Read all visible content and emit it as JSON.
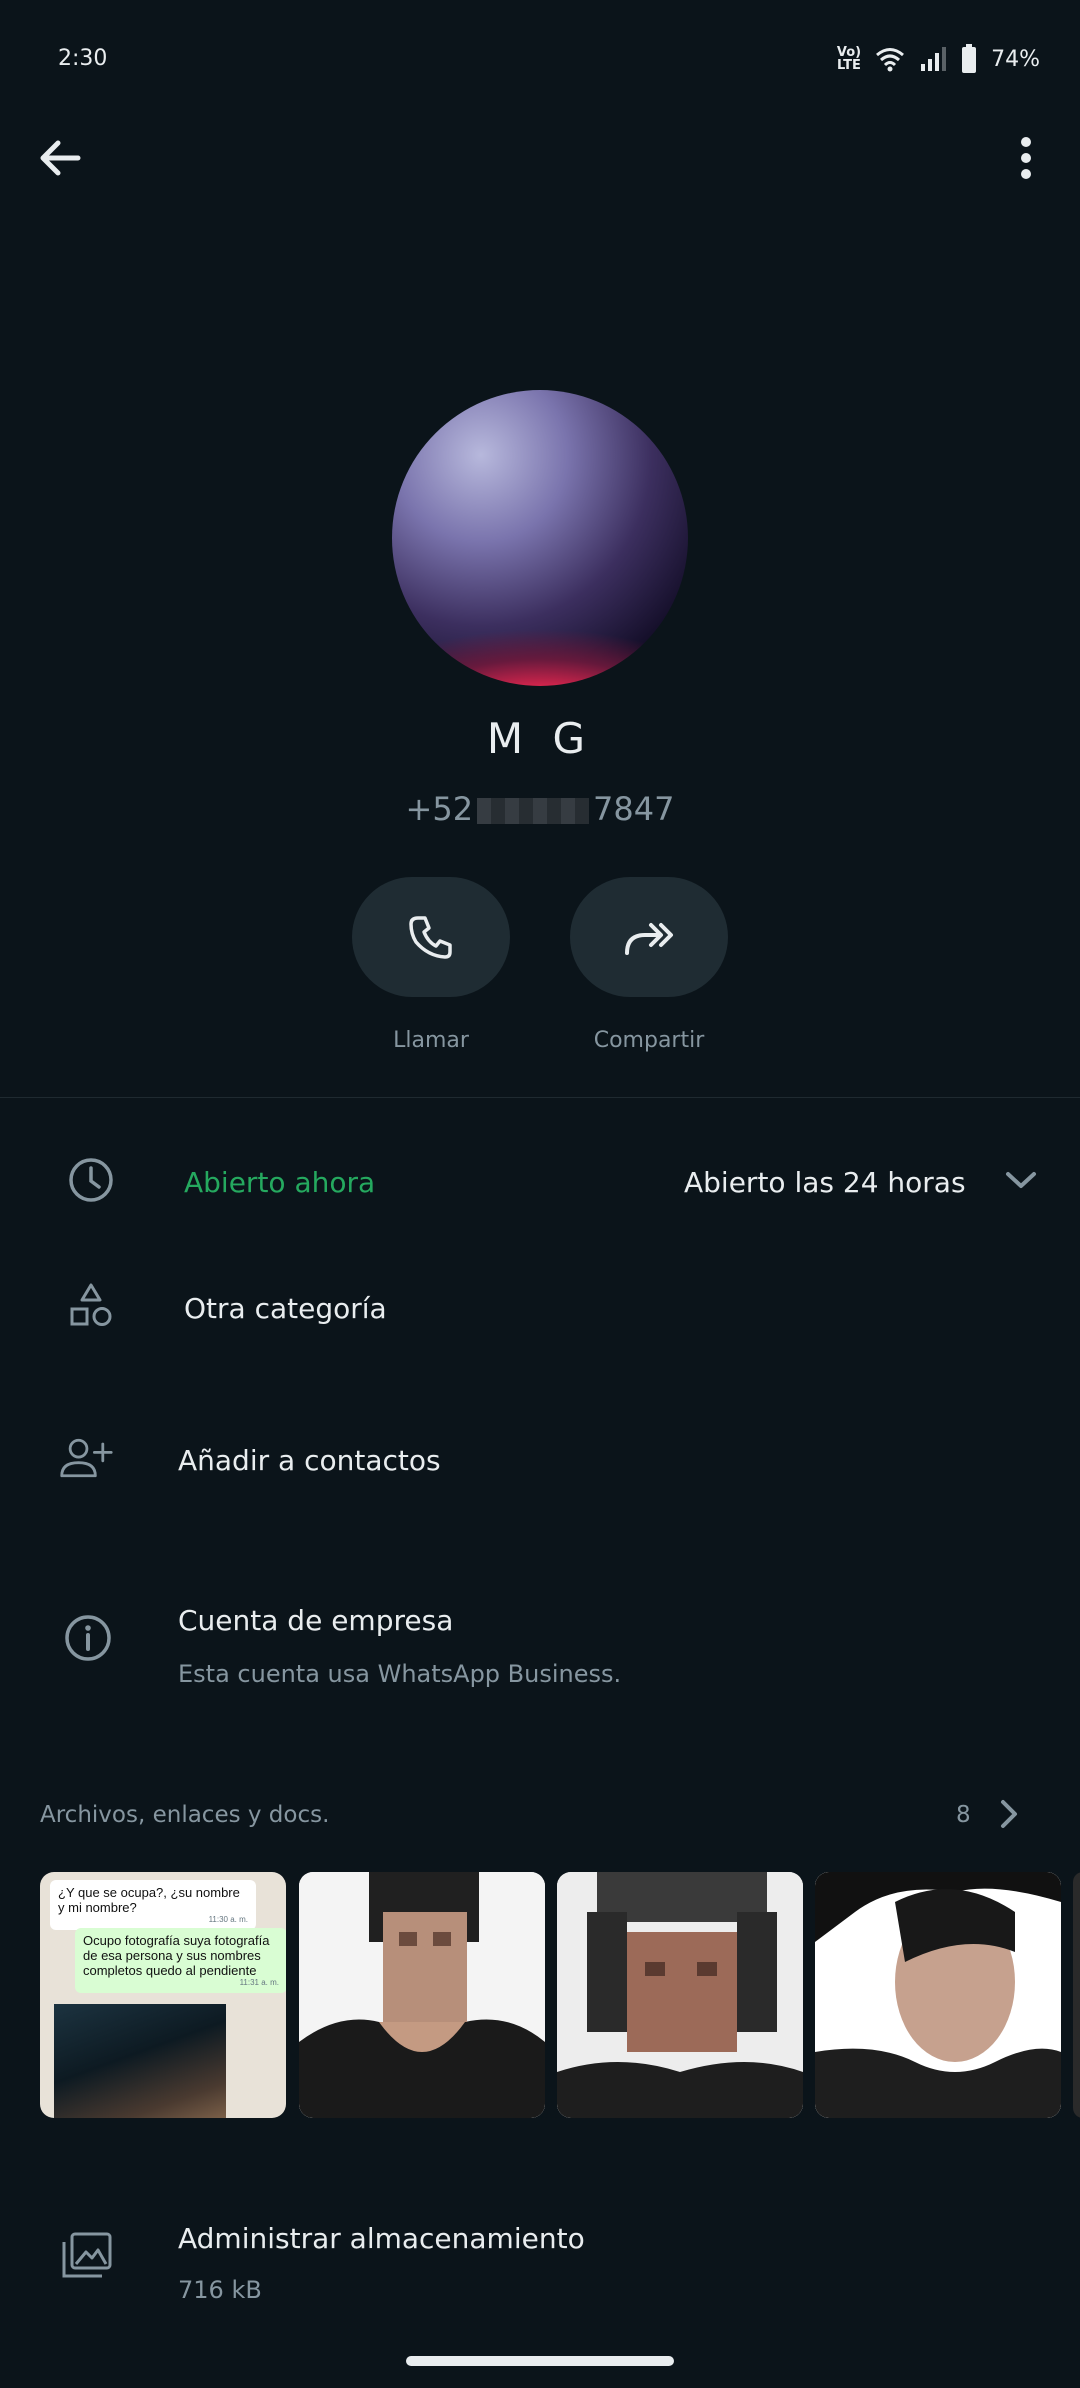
{
  "status_bar": {
    "time": "2:30",
    "network": "Vo) LTE",
    "battery": "74%",
    "icons": [
      "volte-icon",
      "wifi-icon",
      "signal-icon",
      "battery-icon"
    ]
  },
  "header": {
    "back_icon": "arrow-left-icon",
    "more_icon": "more-vertical-icon"
  },
  "contact": {
    "name": "M G",
    "phone_prefix": "+52",
    "phone_suffix": "7847"
  },
  "actions": [
    {
      "label": "Llamar",
      "icon": "phone-icon"
    },
    {
      "label": "Compartir",
      "icon": "share-icon"
    }
  ],
  "hours": {
    "status": "Abierto ahora",
    "value": "Abierto las 24 horas",
    "status_color": "#25a95f",
    "icon": "clock-icon"
  },
  "category": {
    "label": "Otra categoría",
    "icon": "shapes-icon"
  },
  "add_contact": {
    "label": "Añadir a contactos",
    "icon": "add-person-icon"
  },
  "business": {
    "title": "Cuenta de empresa",
    "subtitle": "Esta cuenta usa WhatsApp Business.",
    "icon": "info-icon"
  },
  "media": {
    "label": "Archivos, enlaces y docs.",
    "count": "8",
    "thumb1": {
      "incoming": "¿Y que se ocupa?, ¿su nombre y mi nombre?",
      "incoming_time": "11:30 a. m.",
      "outgoing": "Ocupo fotografía suya fotografía de esa persona y sus nombres completos quedo al pendiente",
      "outgoing_time": "11:31 a. m."
    }
  },
  "storage": {
    "title": "Administrar almacenamiento",
    "size": "716 kB",
    "icon": "storage-icon"
  },
  "colors": {
    "background": "#0b141a",
    "accent_green": "#25a95f",
    "secondary_text": "#8696a0",
    "button_bg": "#1f2c33"
  }
}
